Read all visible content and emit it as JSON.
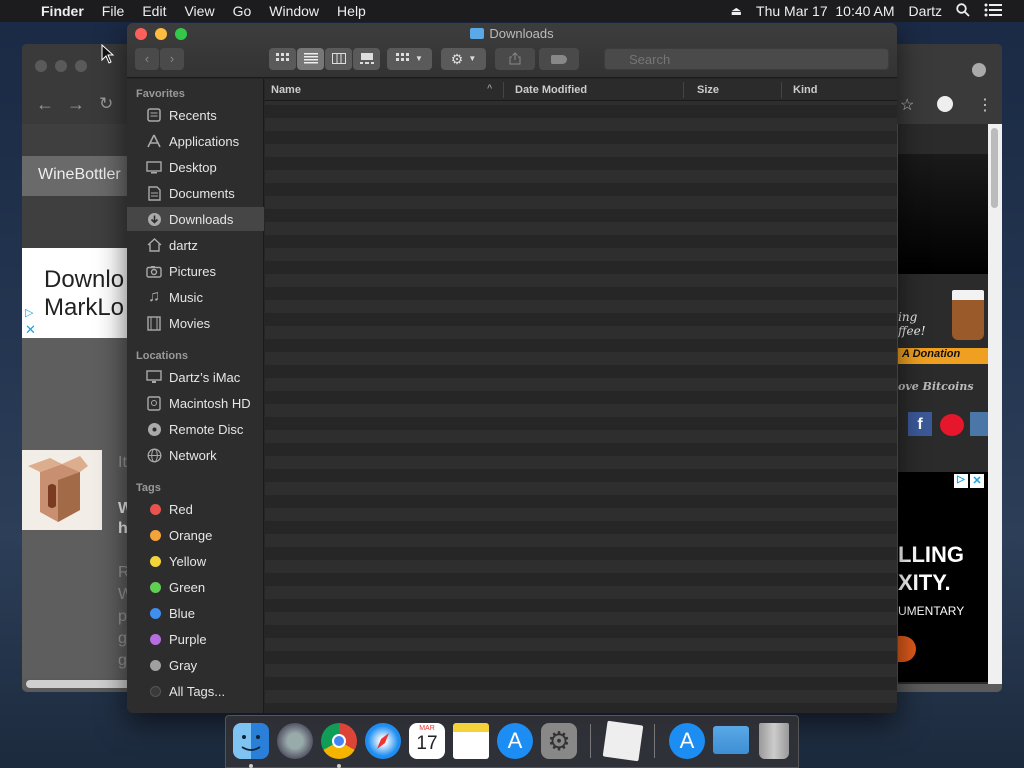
{
  "menubar": {
    "apple": "",
    "app_name": "Finder",
    "menus": [
      "File",
      "Edit",
      "View",
      "Go",
      "Window",
      "Help"
    ],
    "clock": "Thu Mar 17  10:40 AM",
    "user": "Dartz"
  },
  "browser": {
    "bookmark_label": "WineBottler",
    "ad_line1": "Downlo",
    "ad_line2": "MarkLo",
    "right_text1": "ing",
    "right_text2": "ffee!",
    "donation": "A Donation",
    "bitcoins": "ove Bitcoins",
    "ad_big1": "LLING",
    "ad_big2": "XITY.",
    "ad_small": "UMENTARY",
    "edge_letters": [
      "It",
      "W",
      "h",
      "R",
      "W",
      "p",
      "g",
      "g"
    ]
  },
  "finder": {
    "title": "Downloads",
    "search_placeholder": "Search",
    "columns": {
      "name": "Name",
      "date": "Date Modified",
      "size": "Size",
      "kind": "Kind"
    },
    "sidebar": {
      "favorites_header": "Favorites",
      "favorites": [
        {
          "label": "Recents",
          "icon": "recents-icon"
        },
        {
          "label": "Applications",
          "icon": "applications-icon"
        },
        {
          "label": "Desktop",
          "icon": "desktop-icon"
        },
        {
          "label": "Documents",
          "icon": "documents-icon"
        },
        {
          "label": "Downloads",
          "icon": "downloads-icon",
          "selected": true
        },
        {
          "label": "dartz",
          "icon": "home-icon"
        },
        {
          "label": "Pictures",
          "icon": "pictures-icon"
        },
        {
          "label": "Music",
          "icon": "music-icon"
        },
        {
          "label": "Movies",
          "icon": "movies-icon"
        }
      ],
      "locations_header": "Locations",
      "locations": [
        {
          "label": "Dartz’s iMac",
          "icon": "imac-icon"
        },
        {
          "label": "Macintosh HD",
          "icon": "harddisk-icon"
        },
        {
          "label": "Remote Disc",
          "icon": "disc-icon"
        },
        {
          "label": "Network",
          "icon": "network-icon"
        }
      ],
      "tags_header": "Tags",
      "tags": [
        {
          "label": "Red",
          "color": "#e8544d"
        },
        {
          "label": "Orange",
          "color": "#f5a23a"
        },
        {
          "label": "Yellow",
          "color": "#f3d33a"
        },
        {
          "label": "Green",
          "color": "#5fcf52"
        },
        {
          "label": "Blue",
          "color": "#3d8ff0"
        },
        {
          "label": "Purple",
          "color": "#b46ee0"
        },
        {
          "label": "Gray",
          "color": "#a0a0a0"
        },
        {
          "label": "All Tags...",
          "color": "#3a3a3a"
        }
      ]
    }
  },
  "dock": {
    "calendar_month": "MAR",
    "calendar_day": "17"
  }
}
